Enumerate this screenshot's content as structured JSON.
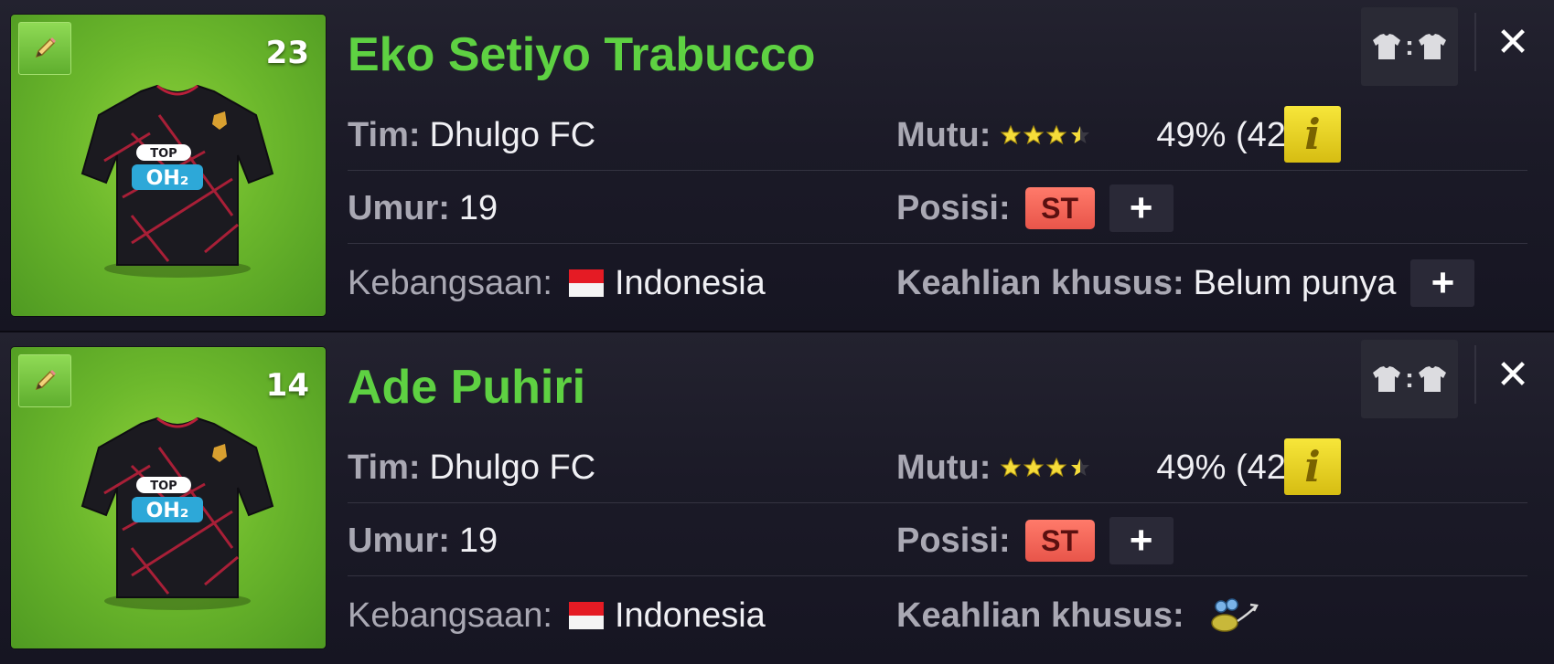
{
  "players": [
    {
      "number": "23",
      "name": "Eko Setiyo Trabucco",
      "team_label": "Tim:",
      "team": "Dhulgo FC",
      "age_label": "Umur:",
      "age": "19",
      "nationality_label": "Kebangsaan:",
      "nationality": "Indonesia",
      "quality_label": "Mutu:",
      "quality_stars": 3.5,
      "quality_percent": "49% (42)",
      "position_label": "Posisi:",
      "position": "ST",
      "special_label": "Keahlian khusus:",
      "special_value": "Belum punya",
      "has_special_icon": false
    },
    {
      "number": "14",
      "name": "Ade Puhiri",
      "team_label": "Tim:",
      "team": "Dhulgo FC",
      "age_label": "Umur:",
      "age": "19",
      "nationality_label": "Kebangsaan:",
      "nationality": "Indonesia",
      "quality_label": "Mutu:",
      "quality_stars": 3.5,
      "quality_percent": "49% (42)",
      "position_label": "Posisi:",
      "position": "ST",
      "special_label": "Keahlian khusus:",
      "special_value": "",
      "has_special_icon": true
    }
  ],
  "icons": {
    "edit": "pencil-icon",
    "info": "info-icon",
    "kit": "kit-swap-icon",
    "close": "close-icon",
    "plus": "plus-icon",
    "special": "skill-icon"
  },
  "glyphs": {
    "plus": "+",
    "close": "✕",
    "info": "i",
    "kit_sep": ":"
  },
  "colors": {
    "name": "#5ed142",
    "badge": "#e8554a",
    "info": "#f0dc2a"
  }
}
